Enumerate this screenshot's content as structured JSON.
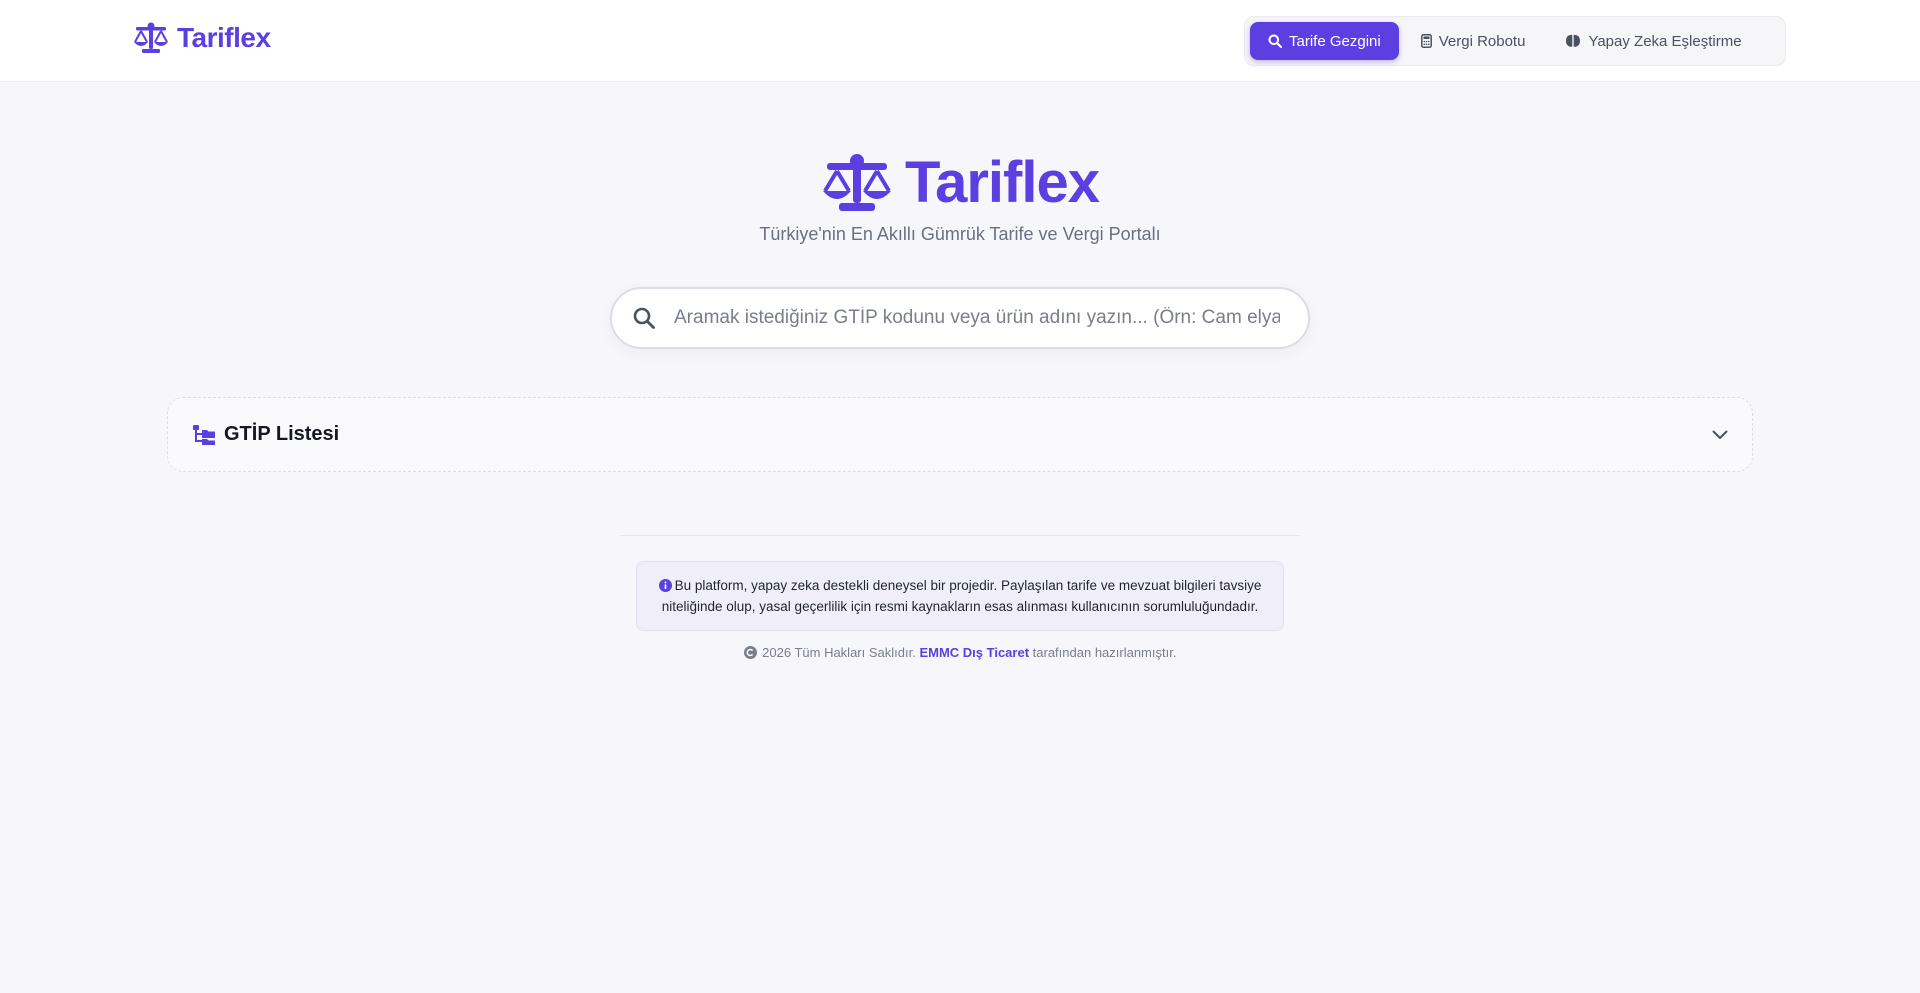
{
  "header": {
    "brand": "Tariflex",
    "nav": [
      {
        "label": "Tarife Gezgini",
        "icon": "search-icon",
        "active": true
      },
      {
        "label": "Vergi Robotu",
        "icon": "calculator-icon",
        "active": false
      },
      {
        "label": "Yapay Zeka Eşleştirme",
        "icon": "brain-icon",
        "active": false
      }
    ]
  },
  "hero": {
    "title": "Tariflex",
    "subtitle": "Türkiye'nin En Akıllı Gümrük Tarife ve Vergi Portalı"
  },
  "search": {
    "placeholder": "Aramak istediğiniz GTİP kodunu veya ürün adını yazın... (Örn: Cam elyaf,"
  },
  "gtip_list": {
    "title": "GTİP Listesi"
  },
  "notice": {
    "text": "Bu platform, yapay zeka destekli deneysel bir projedir. Paylaşılan tarife ve mevzuat bilgileri tavsiye niteliğinde olup, yasal geçerlilik için resmi kaynakların esas alınması kullanıcının sorumluluğundadır."
  },
  "footer": {
    "prefix": "2026 Tüm Hakları Saklıdır.",
    "company": "EMMC Dış Ticaret",
    "suffix": "tarafından hazırlanmıştır."
  },
  "colors": {
    "accent": "#5b3fe0",
    "background": "#f7f7fb"
  }
}
